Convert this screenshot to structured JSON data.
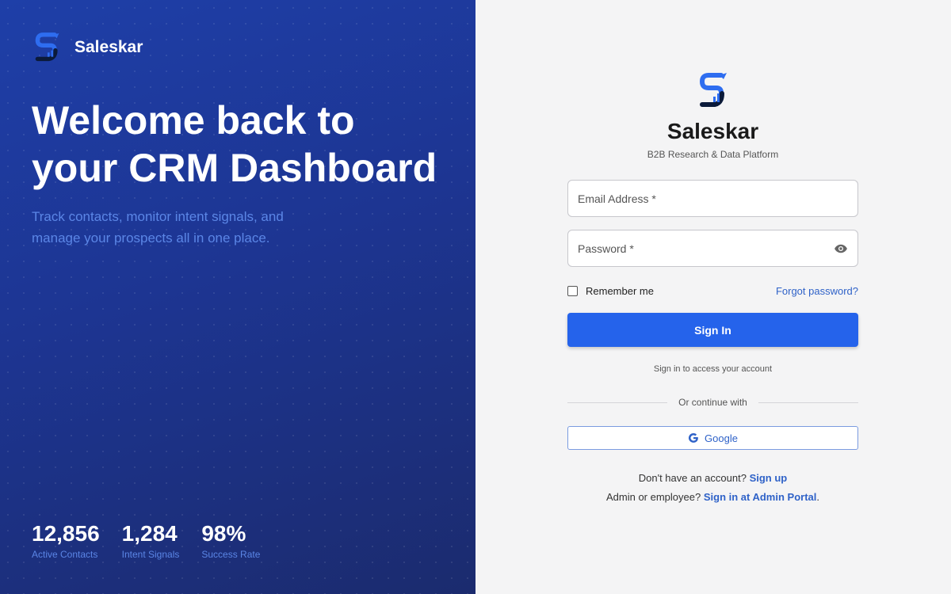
{
  "brand": {
    "name": "Saleskar"
  },
  "hero": {
    "headline_line1": "Welcome back to",
    "headline_line2": "your CRM Dashboard",
    "subtext": "Track contacts, monitor intent signals, and manage your prospects all in one place."
  },
  "stats": [
    {
      "value": "12,856",
      "label": "Active Contacts"
    },
    {
      "value": "1,284",
      "label": "Intent Signals"
    },
    {
      "value": "98%",
      "label": "Success Rate"
    }
  ],
  "form": {
    "title": "Saleskar",
    "subtitle": "B2B Research & Data Platform",
    "email_label": "Email Address *",
    "password_label": "Password *",
    "remember_label": "Remember me",
    "forgot_label": "Forgot password?",
    "signin_label": "Sign In",
    "hint": "Sign in to access your account",
    "divider_text": "Or continue with",
    "google_label": "Google"
  },
  "footer": {
    "signup_prefix": "Don't have an account?",
    "signup_link": "Sign up",
    "admin_prefix": "Admin or employee?",
    "admin_link": "Sign in at Admin Portal",
    "admin_suffix": "."
  },
  "colors": {
    "accent": "#2563eb",
    "link": "#2f62c8",
    "panel_dark": "#1d3592"
  },
  "icons": {
    "brand": "saleskar-logo-icon",
    "password_toggle": "eye-icon",
    "google": "google-icon"
  }
}
